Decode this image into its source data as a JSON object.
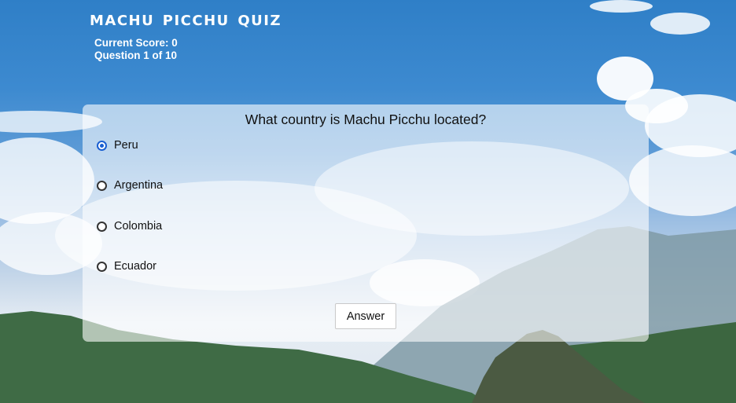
{
  "header": {
    "title": "Machu Picchu Quiz",
    "score": "Current Score: 0",
    "progress": "Question 1 of 10"
  },
  "quiz": {
    "question": "What country is Machu Picchu located?",
    "options": [
      {
        "label": "Peru",
        "selected": true
      },
      {
        "label": "Argentina",
        "selected": false
      },
      {
        "label": "Colombia",
        "selected": false
      },
      {
        "label": "Ecuador",
        "selected": false
      }
    ],
    "submit_label": "Answer"
  },
  "theme": {
    "selected_radio": "#1a5fd1",
    "text": "#111111",
    "title_color": "#ffffff"
  }
}
